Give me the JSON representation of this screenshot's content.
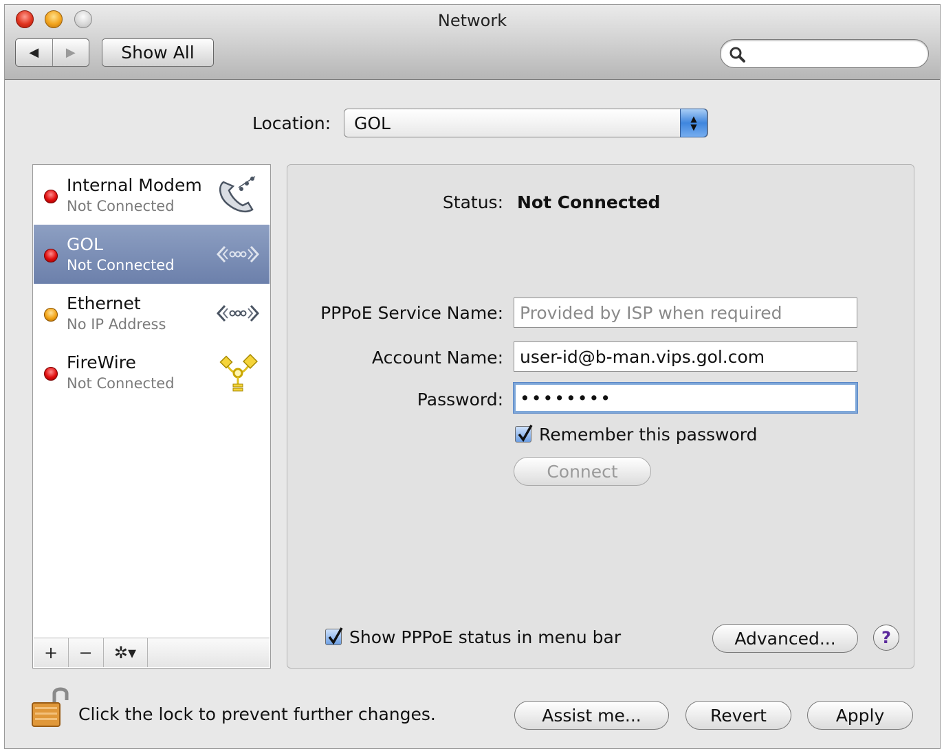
{
  "window": {
    "title": "Network"
  },
  "toolbar": {
    "back_icon": "◀",
    "forward_icon": "▶",
    "show_all_label": "Show All",
    "search_placeholder": ""
  },
  "location": {
    "label": "Location:",
    "value": "GOL"
  },
  "services": [
    {
      "name": "Internal Modem",
      "status": "Not Connected",
      "status_color": "red",
      "icon": "phone-modem-icon",
      "selected": false
    },
    {
      "name": "GOL",
      "status": "Not Connected",
      "status_color": "red",
      "icon": "pppoe-ethernet-icon",
      "selected": true
    },
    {
      "name": "Ethernet",
      "status": "No IP Address",
      "status_color": "orange",
      "icon": "ethernet-icon",
      "selected": false
    },
    {
      "name": "FireWire",
      "status": "Not Connected",
      "status_color": "red",
      "icon": "firewire-icon",
      "selected": false
    }
  ],
  "list_bar": {
    "add": "+",
    "remove": "−",
    "action": "✲▾"
  },
  "detail": {
    "status_label": "Status:",
    "status_value": "Not Connected",
    "service_name_label": "PPPoE Service Name:",
    "service_name_placeholder": "Provided by ISP when required",
    "account_label": "Account Name:",
    "account_value": "user-id@b-man.vips.gol.com",
    "password_label": "Password:",
    "password_value": "••••••••",
    "remember_label": "Remember this password",
    "remember_checked": true,
    "connect_label": "Connect",
    "show_status_label": "Show PPPoE status in menu bar",
    "show_status_checked": true,
    "advanced_label": "Advanced...",
    "help_label": "?"
  },
  "footer": {
    "lock_text": "Click the lock to prevent further changes.",
    "assist_label": "Assist me...",
    "revert_label": "Revert",
    "apply_label": "Apply"
  },
  "colors": {
    "selection": "#7486b1",
    "status_red": "#e00d0d",
    "status_orange": "#f2a316",
    "focus_ring": "#7ea7d9"
  }
}
